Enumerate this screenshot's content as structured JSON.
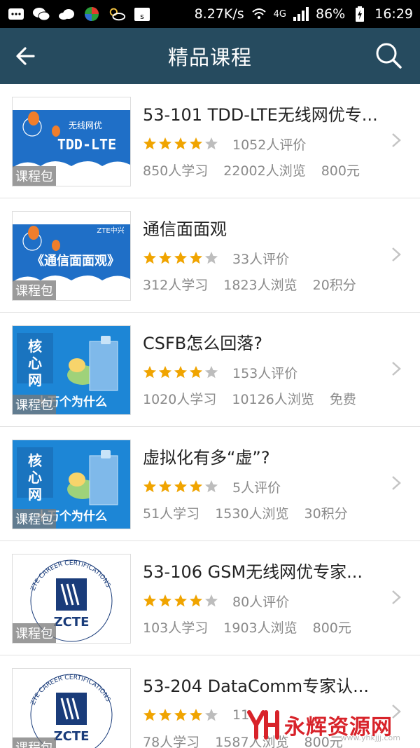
{
  "status_bar": {
    "speed": "8.27K/s",
    "network": "4G",
    "battery": "86%",
    "time": "16:29"
  },
  "header": {
    "title": "精品课程"
  },
  "courses": [
    {
      "title": "53-101 TDD-LTE无线网优专...",
      "badge": "课程包",
      "thumb_text": "TDD-LTE",
      "thumb_sub": "无线网优",
      "rating": 4,
      "reviews": "1052人评价",
      "learners": "850人学习",
      "views": "22002人浏览",
      "price": "800元"
    },
    {
      "title": "通信面面观",
      "badge": "课程包",
      "thumb_text": "《通信面面观》",
      "thumb_sub": "ZTE中兴",
      "rating": 4,
      "reviews": "33人评价",
      "learners": "312人学习",
      "views": "1823人浏览",
      "price": "20积分"
    },
    {
      "title": "CSFB怎么回落?",
      "badge": "课程包",
      "thumb_text": "核心网",
      "thumb_sub": "十万个为什么",
      "rating": 4,
      "reviews": "153人评价",
      "learners": "1020人学习",
      "views": "10126人浏览",
      "price": "免费"
    },
    {
      "title": "虚拟化有多“虚”?",
      "badge": "课程包",
      "thumb_text": "核心网",
      "thumb_sub": "十万个为什么",
      "rating": 4,
      "reviews": "5人评价",
      "learners": "51人学习",
      "views": "1530人浏览",
      "price": "30积分"
    },
    {
      "title": "53-106 GSM无线网优专家...",
      "badge": "课程包",
      "thumb_text": "ZCTE",
      "thumb_sub": "ZTE CAREER CERTIFICATIONS",
      "rating": 4,
      "reviews": "80人评价",
      "learners": "103人学习",
      "views": "1903人浏览",
      "price": "800元"
    },
    {
      "title": "53-204 DataComm专家认...",
      "badge": "课程包",
      "thumb_text": "ZCTE",
      "thumb_sub": "ZTE CAREER CERTIFICATIONS",
      "rating": 4,
      "reviews": "11",
      "learners": "78人学习",
      "views": "1587人浏览",
      "price": "800元"
    }
  ],
  "watermark": {
    "text": "永辉资源网",
    "url": "www.yhkjjj.com"
  },
  "colors": {
    "appbar": "#264b5f",
    "star": "#f0a400",
    "star_empty": "#bdbdbd"
  }
}
